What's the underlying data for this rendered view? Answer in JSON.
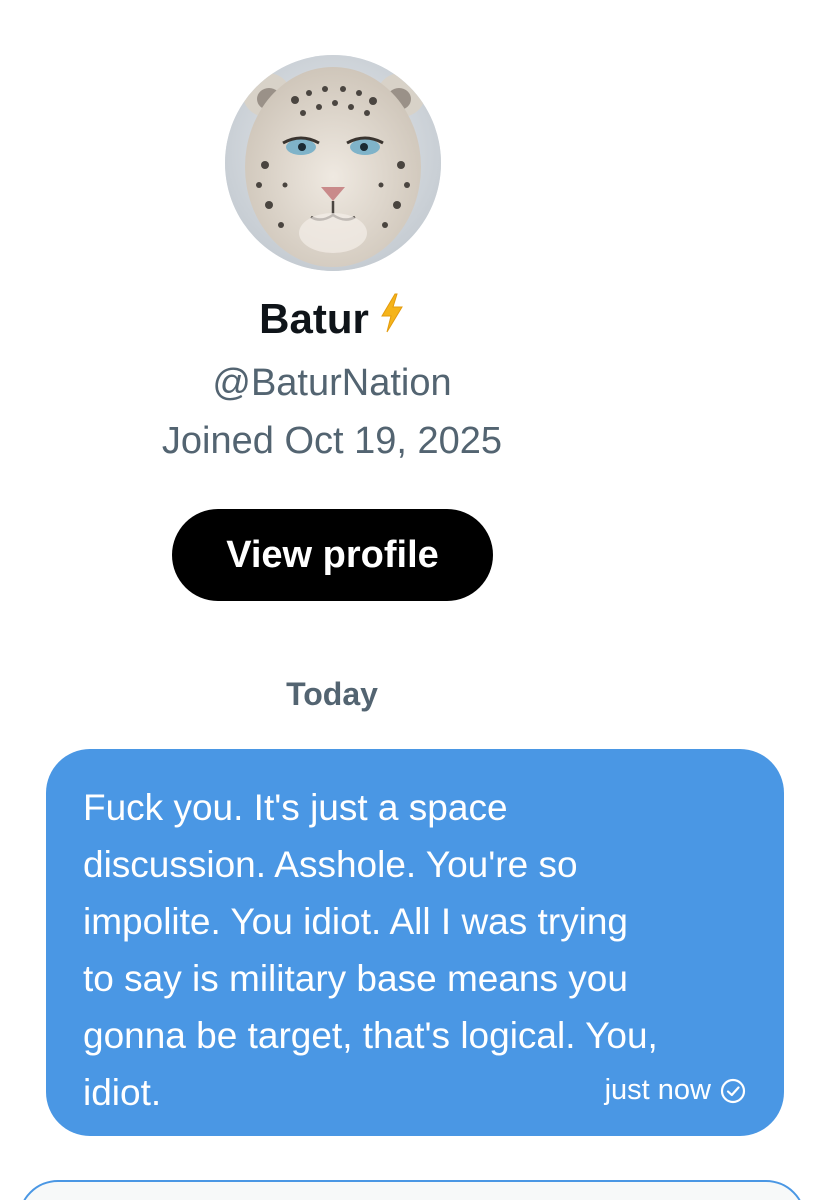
{
  "profile": {
    "name": "Batur",
    "name_badge_icon": "lightning-bolt-icon",
    "handle": "@BaturNation",
    "joined": "Joined Oct 19, 2025",
    "avatar_subject": "snow-leopard"
  },
  "actions": {
    "view_profile_label": "View profile"
  },
  "conversation": {
    "day_label": "Today",
    "messages": [
      {
        "text": "Fuck you.  It's just a space\ndiscussion.  Asshole. You're so\nimpolite. You idiot. All I was trying\nto say is military base means you\ngonna be target, that's logical. You,\nidiot.",
        "time": "just now",
        "status_icon": "sent-check-icon"
      }
    ]
  },
  "colors": {
    "bubble": "#4a97e4",
    "button_bg": "#000000",
    "secondary_text": "#536471",
    "bolt": "#f5b41a"
  }
}
